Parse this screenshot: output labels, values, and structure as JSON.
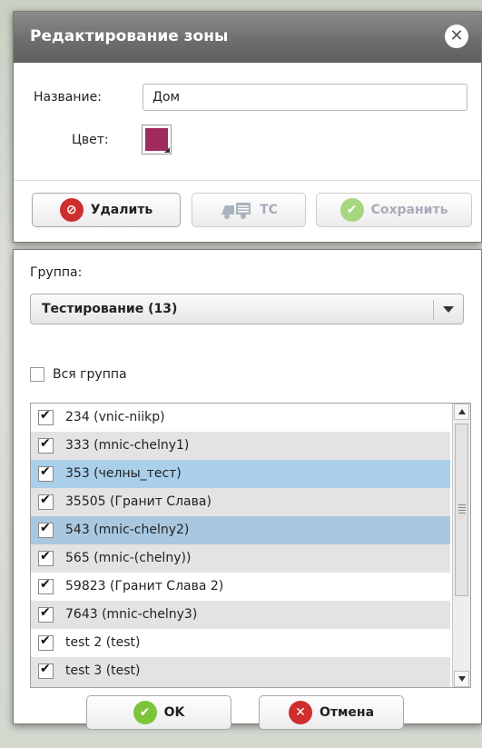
{
  "zone_dialog": {
    "title": "Редактирование зоны",
    "name_label": "Название:",
    "name_value": "Дом",
    "color_label": "Цвет:",
    "color_value": "#a02a5e",
    "buttons": {
      "delete": "Удалить",
      "vehicles": "ТС",
      "save": "Сохранить"
    }
  },
  "group_dialog": {
    "group_label": "Группа:",
    "group_selected": "Тестирование (13)",
    "whole_group_label": "Вся группа",
    "items": [
      {
        "label": "234 (vnic-niikp)",
        "checked": true,
        "bg": "#ffffff"
      },
      {
        "label": "333 (mnic-chelny1)",
        "checked": true,
        "bg": "#e3e3e3"
      },
      {
        "label": "353 (челны_тест)",
        "checked": true,
        "bg": "#a9cfea"
      },
      {
        "label": "35505 (Гранит Слава)",
        "checked": true,
        "bg": "#e3e3e3"
      },
      {
        "label": "543 (mnic-chelny2)",
        "checked": true,
        "bg": "#a9c8e0"
      },
      {
        "label": "565 (mnic-(chelny))",
        "checked": true,
        "bg": "#e3e3e3"
      },
      {
        "label": "59823 (Гранит Слава 2)",
        "checked": true,
        "bg": "#ffffff"
      },
      {
        "label": "7643 (mnic-chelny3)",
        "checked": true,
        "bg": "#e3e3e3"
      },
      {
        "label": "test 2 (test)",
        "checked": true,
        "bg": "#ffffff"
      },
      {
        "label": "test 3 (test)",
        "checked": true,
        "bg": "#e3e3e3"
      }
    ],
    "buttons": {
      "ok": "OK",
      "cancel": "Отмена"
    }
  },
  "icons": {
    "close": "close-icon",
    "delete": "no-entry-icon",
    "vehicles": "truck-icon",
    "save": "checkmark-icon",
    "ok": "checkmark-icon",
    "cancel": "x-circle-icon"
  }
}
